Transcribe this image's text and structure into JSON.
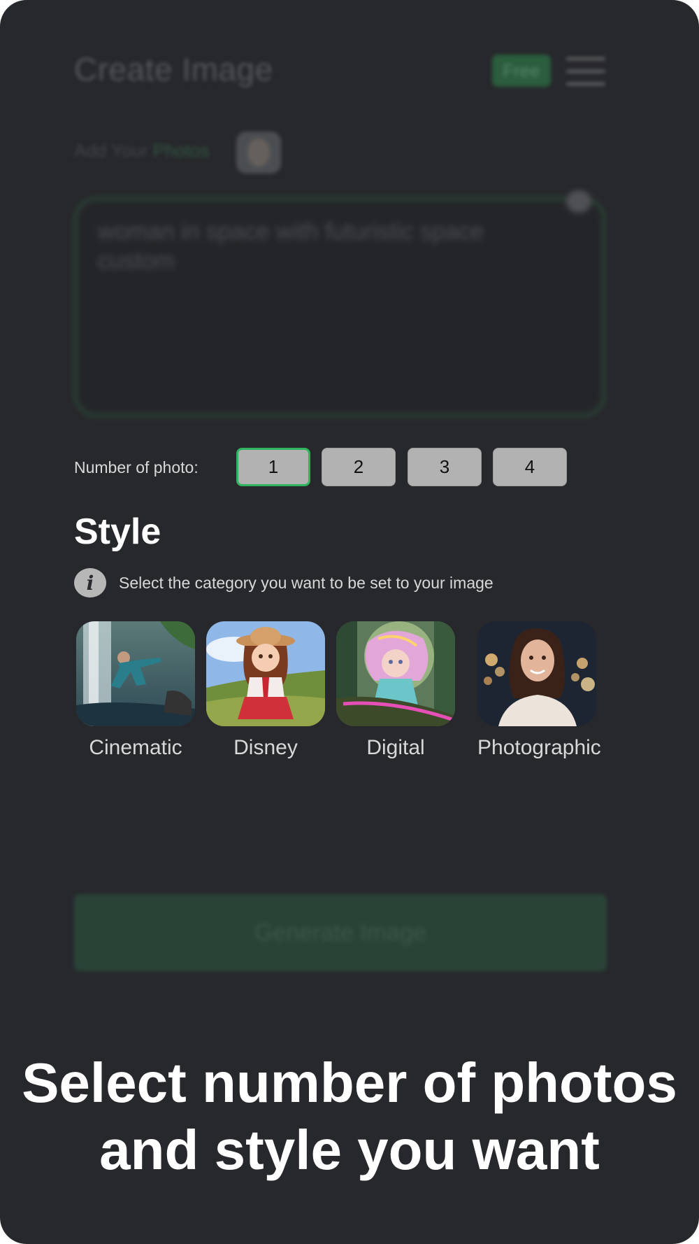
{
  "header": {
    "title": "Create Image",
    "badge": "Free"
  },
  "add_photos": {
    "label_prefix": "Add Your ",
    "label_highlight": "Photos"
  },
  "prompt": {
    "value": "woman in space with futuristic space custom"
  },
  "photo_count": {
    "label": "Number of photo:",
    "options": [
      "1",
      "2",
      "3",
      "4"
    ],
    "selected": "1"
  },
  "style": {
    "title": "Style",
    "info_icon": "i",
    "hint": "Select the category you want to be set to your image",
    "options": [
      {
        "label": "Cinematic",
        "icon": "cinematic-thumbnail"
      },
      {
        "label": "Disney",
        "icon": "disney-thumbnail"
      },
      {
        "label": "Digital",
        "icon": "digital-thumbnail"
      },
      {
        "label": "Photographic",
        "icon": "photographic-thumbnail"
      }
    ]
  },
  "generate": {
    "label": "Generate Image"
  },
  "caption": {
    "line1": "Select number of photos",
    "line2": "and style you want"
  },
  "colors": {
    "background": "#27282c",
    "accent": "#2fb35c",
    "button": "#2c5a41"
  }
}
